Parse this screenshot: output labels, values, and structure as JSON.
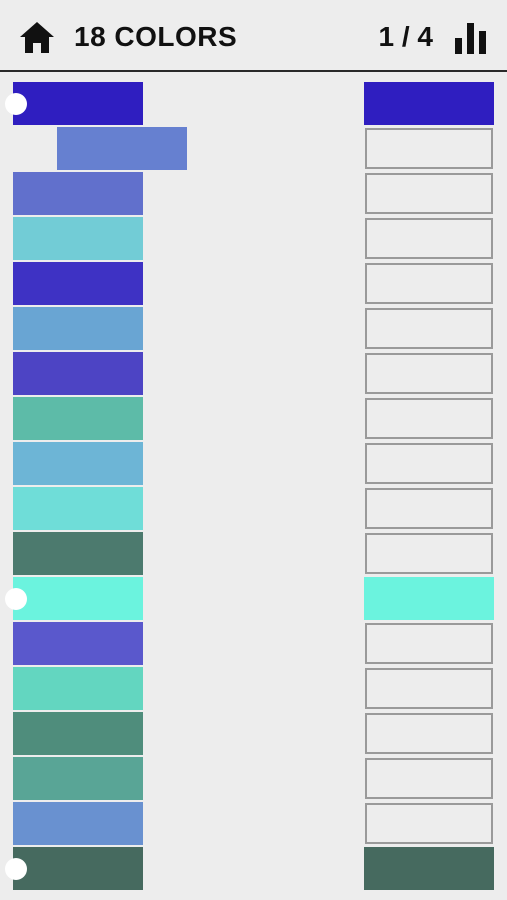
{
  "header": {
    "title": "18 COLORS",
    "page_indicator": "1 / 4",
    "home_icon": "home-icon",
    "stats_icon": "bar-chart-icon"
  },
  "colors": {
    "text": "#111111",
    "background": "#ededed",
    "slot_border": "#9a9a9a"
  },
  "swatches": [
    {
      "color": "#2f1ec0",
      "anchored": true,
      "selected": false
    },
    {
      "color": "#6680d0",
      "anchored": false,
      "selected": true
    },
    {
      "color": "#6170cc",
      "anchored": false,
      "selected": false
    },
    {
      "color": "#72ccd6",
      "anchored": false,
      "selected": false
    },
    {
      "color": "#3e32c4",
      "anchored": false,
      "selected": false
    },
    {
      "color": "#69a5d3",
      "anchored": false,
      "selected": false
    },
    {
      "color": "#4d44c4",
      "anchored": false,
      "selected": false
    },
    {
      "color": "#5dbba8",
      "anchored": false,
      "selected": false
    },
    {
      "color": "#6db5d6",
      "anchored": false,
      "selected": false
    },
    {
      "color": "#6fddd8",
      "anchored": false,
      "selected": false
    },
    {
      "color": "#4c7a6e",
      "anchored": false,
      "selected": false
    },
    {
      "color": "#6bf3de",
      "anchored": true,
      "selected": false
    },
    {
      "color": "#5a58cc",
      "anchored": false,
      "selected": false
    },
    {
      "color": "#63d6c0",
      "anchored": false,
      "selected": false
    },
    {
      "color": "#4f8d7c",
      "anchored": false,
      "selected": false
    },
    {
      "color": "#59a596",
      "anchored": false,
      "selected": false
    },
    {
      "color": "#6991d0",
      "anchored": false,
      "selected": false
    },
    {
      "color": "#466a5f",
      "anchored": true,
      "selected": false
    }
  ],
  "slots": [
    {
      "filled": true,
      "color": "#2f1ec0"
    },
    {
      "filled": false
    },
    {
      "filled": false
    },
    {
      "filled": false
    },
    {
      "filled": false
    },
    {
      "filled": false
    },
    {
      "filled": false
    },
    {
      "filled": false
    },
    {
      "filled": false
    },
    {
      "filled": false
    },
    {
      "filled": false
    },
    {
      "filled": true,
      "color": "#6bf3de"
    },
    {
      "filled": false
    },
    {
      "filled": false
    },
    {
      "filled": false
    },
    {
      "filled": false
    },
    {
      "filled": false
    },
    {
      "filled": true,
      "color": "#466a5f"
    }
  ]
}
